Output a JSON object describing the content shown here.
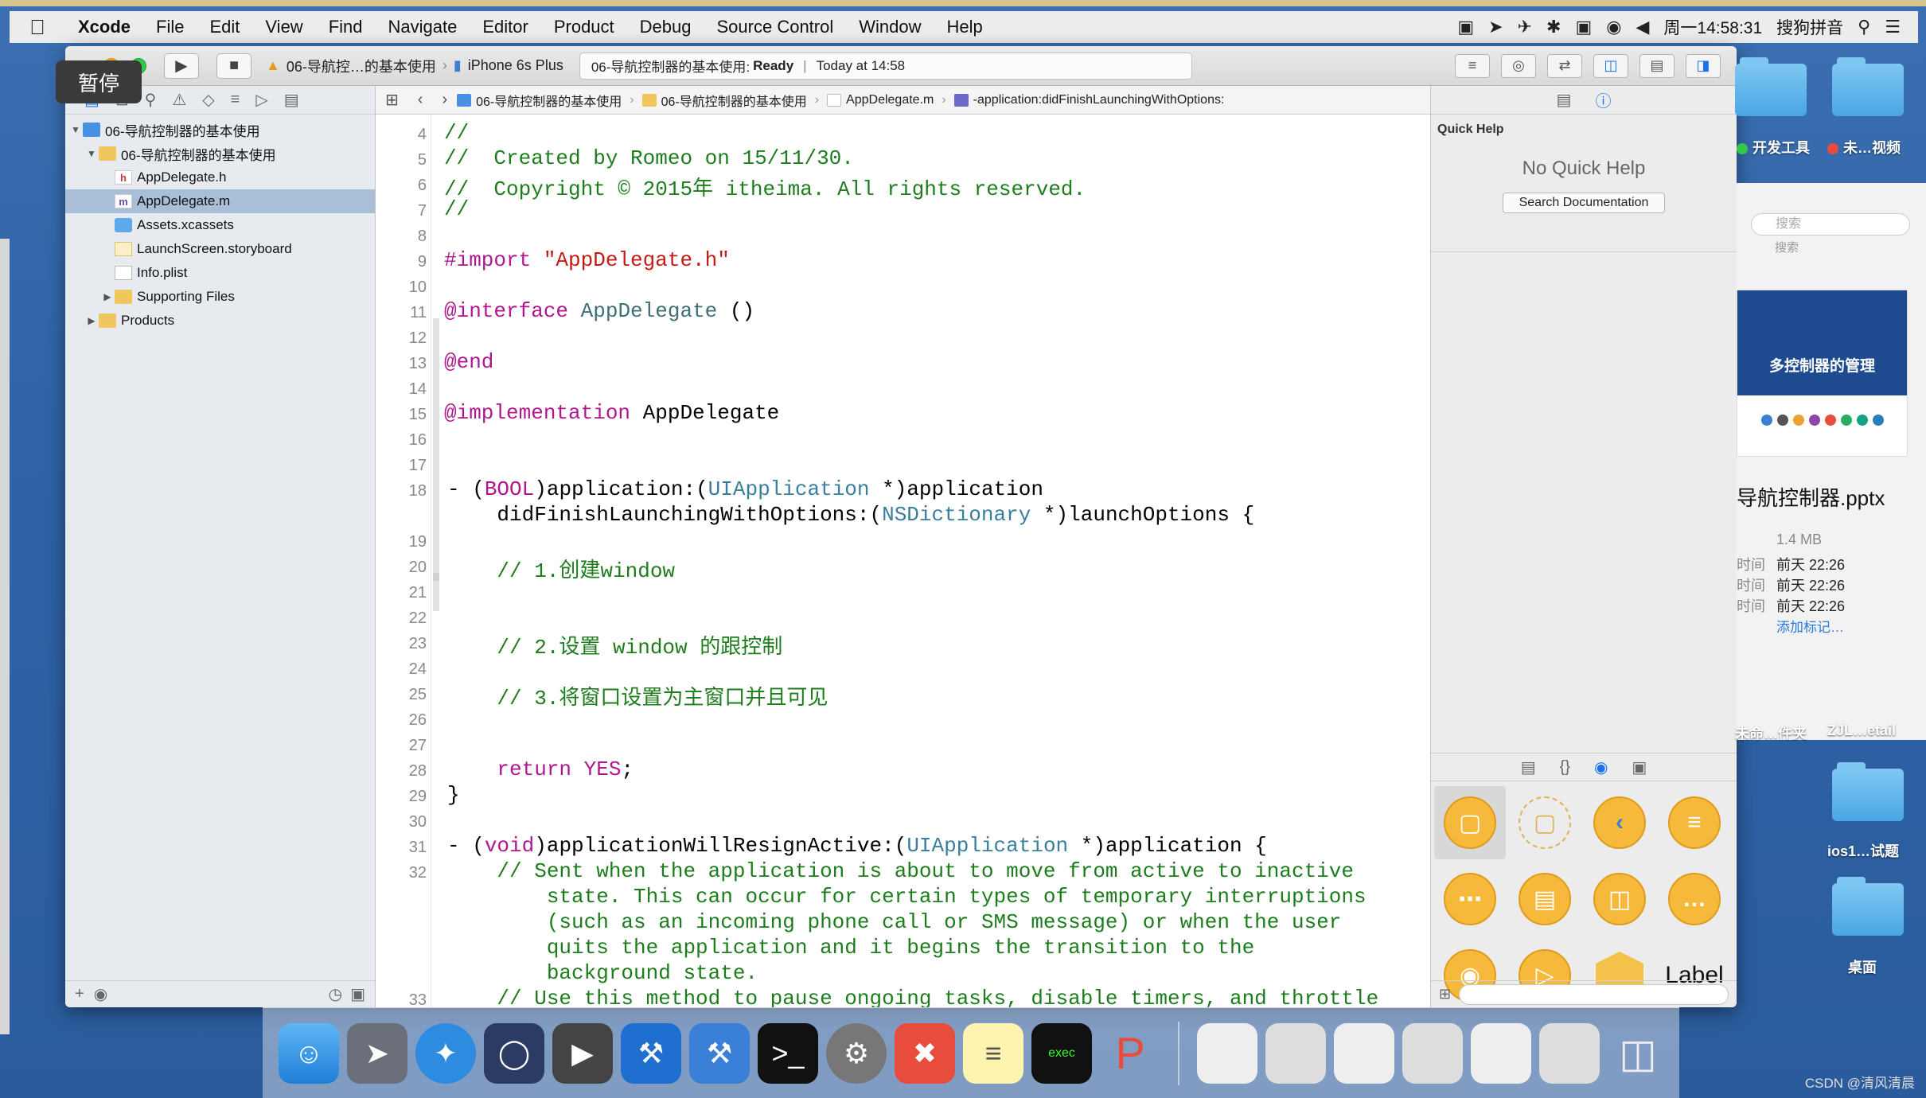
{
  "menubar": {
    "app_name": "Xcode",
    "items": [
      "File",
      "Edit",
      "View",
      "Find",
      "Navigate",
      "Editor",
      "Product",
      "Debug",
      "Source Control",
      "Window",
      "Help"
    ],
    "clock": "周一14:58:31",
    "input_method": "搜狗拼音"
  },
  "overlay": {
    "pause_label": "暂停"
  },
  "toolbar": {
    "scheme": "06-导航控…的基本使用",
    "device": "iPhone 6s Plus",
    "status_project": "06-导航控制器的基本使用:",
    "status_state": "Ready",
    "status_time": "Today at 14:58"
  },
  "navigator": {
    "project": "06-导航控制器的基本使用",
    "group": "06-导航控制器的基本使用",
    "files": [
      {
        "name": "AppDelegate.h",
        "type": "h"
      },
      {
        "name": "AppDelegate.m",
        "type": "m",
        "selected": true
      },
      {
        "name": "Assets.xcassets",
        "type": "assets"
      },
      {
        "name": "LaunchScreen.storyboard",
        "type": "storyboard"
      },
      {
        "name": "Info.plist",
        "type": "plist"
      }
    ],
    "supporting": "Supporting Files",
    "products": "Products"
  },
  "jumpbar": {
    "crumbs": [
      "06-导航控制器的基本使用",
      "06-导航控制器的基本使用",
      "AppDelegate.m",
      "-application:didFinishLaunchingWithOptions:"
    ]
  },
  "editor": {
    "line_numbers": [
      "4",
      "5",
      "6",
      "7",
      "8",
      "9",
      "10",
      "11",
      "12",
      "13",
      "14",
      "15",
      "16",
      "17",
      "18",
      "19",
      "20",
      "21",
      "22",
      "23",
      "24",
      "25",
      "26",
      "27",
      "28",
      "29",
      "30",
      "31",
      "32",
      "33"
    ],
    "lines": {
      "l4": "//",
      "l5": "//  Created by Romeo on 15/11/30.",
      "l6": "//  Copyright © 2015年 itheima. All rights reserved.",
      "l7": "//",
      "l9_kw": "#import",
      "l9_str": "\"AppDelegate.h\"",
      "l11_kw": "@interface",
      "l11_cls": "AppDelegate",
      "l11_rest": " ()",
      "l13": "@end",
      "l15_kw": "@implementation",
      "l15_rest": " AppDelegate",
      "l18_a": "- (",
      "l18_bool": "BOOL",
      "l18_b": ")application:(",
      "l18_type": "UIApplication",
      "l18_c": " *)application",
      "l18w_a": "    didFinishLaunchingWithOptions:(",
      "l18w_type": "NSDictionary",
      "l18w_b": " *)launchOptions {",
      "l20": "    // 1.创建window",
      "l23": "    // 2.设置 window 的跟控制",
      "l25": "    // 3.将窗口设置为主窗口并且可见",
      "l28_kw": "    return",
      "l28_val": " YES",
      "l28_end": ";",
      "l29": "}",
      "l31_a": "- (",
      "l31_void": "void",
      "l31_b": ")applicationWillResignActive:(",
      "l31_type": "UIApplication",
      "l31_c": " *)application {",
      "l32_1": "    // Sent when the application is about to move from active to inactive",
      "l32_2": "        state. This can occur for certain types of temporary interruptions",
      "l32_3": "        (such as an incoming phone call or SMS message) or when the user",
      "l32_4": "        quits the application and it begins the transition to the",
      "l32_5": "        background state.",
      "l33": "    // Use this method to pause ongoing tasks, disable timers, and throttle"
    }
  },
  "quick_help": {
    "title": "Quick Help",
    "empty": "No Quick Help",
    "search_button": "Search Documentation"
  },
  "library": {
    "label_item": "Label"
  },
  "desktop": {
    "folder1": "开发工具",
    "folder2": "未…视频",
    "search_placeholder": "搜索",
    "search_caption": "搜索",
    "thumb_title": "多控制器的管理",
    "file_name": "导航控制器.pptx",
    "file_size": "1.4 MB",
    "meta_key": "时间",
    "meta_values": [
      "前天 22:26",
      "前天 22:26",
      "前天 22:26"
    ],
    "add_tag": "添加标记…",
    "bottom_left": "未命…件夹",
    "bottom_right": "ZJL…etail",
    "folder3": "ios1…试题",
    "folder4": "桌面"
  },
  "watermark": "CSDN @清风清晨",
  "colors": {
    "comment": "#1d7d1d",
    "keyword": "#b0178f",
    "string": "#c41a16",
    "type": "#3a7e9e",
    "selection": "#a9bfd8"
  }
}
